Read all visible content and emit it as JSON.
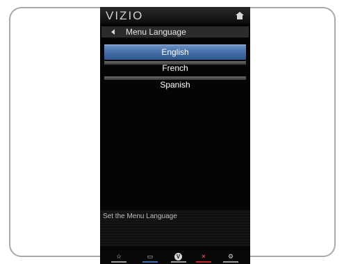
{
  "header": {
    "logo": "VIZIO",
    "home_icon": "home-icon"
  },
  "menu": {
    "title": "Menu Language",
    "back_icon": "left-arrow-icon",
    "options": [
      {
        "label": "English",
        "selected": true
      },
      {
        "label": "French",
        "selected": false
      },
      {
        "label": "Spanish",
        "selected": false
      }
    ],
    "highlight_color": "#4a73ac"
  },
  "description": "Set the Menu Language",
  "bottom_bar": {
    "buttons": [
      {
        "icon": "star-icon",
        "glyph": "☆",
        "color": "#9a9a9a"
      },
      {
        "icon": "widget-icon",
        "glyph": "▭",
        "color": "#3e6fb5"
      },
      {
        "icon": "vizio-v-icon",
        "glyph": "V",
        "color": "#9a9a9a"
      },
      {
        "icon": "close-icon",
        "glyph": "×",
        "color": "#c62828"
      },
      {
        "icon": "gear-icon",
        "glyph": "⚙",
        "color": "#9a9a9a"
      }
    ]
  }
}
